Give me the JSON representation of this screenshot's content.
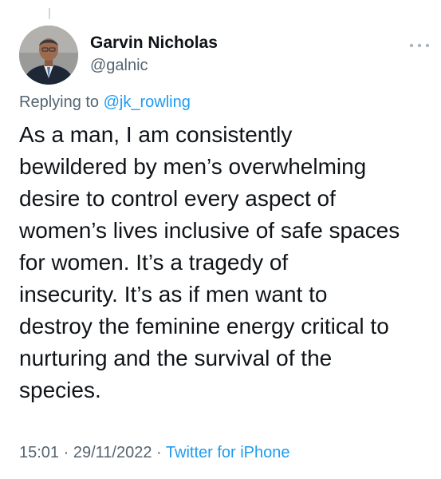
{
  "author": {
    "name": "Garvin Nicholas",
    "handle": "@galnic"
  },
  "reply": {
    "prefix": "Replying to ",
    "mention": "@jk_rowling"
  },
  "tweet": {
    "lines": [
      "As a man, I am consistently",
      "bewildered by men’s overwhelming",
      "desire to control every aspect of",
      "women’s lives inclusive of safe spaces",
      "for women. It’s a tragedy of",
      "insecurity. It’s as if men want to",
      "destroy the feminine energy critical to",
      "nurturing and the survival of the",
      "species."
    ]
  },
  "meta": {
    "time": "15:01",
    "separator": " · ",
    "date": "29/11/2022",
    "source": "Twitter for iPhone"
  },
  "icons": {
    "more": "more-options-icon",
    "avatar": "profile-photo"
  },
  "colors": {
    "link": "#1d9bf0",
    "secondary_text": "#536471",
    "primary_text": "#0f1419"
  }
}
